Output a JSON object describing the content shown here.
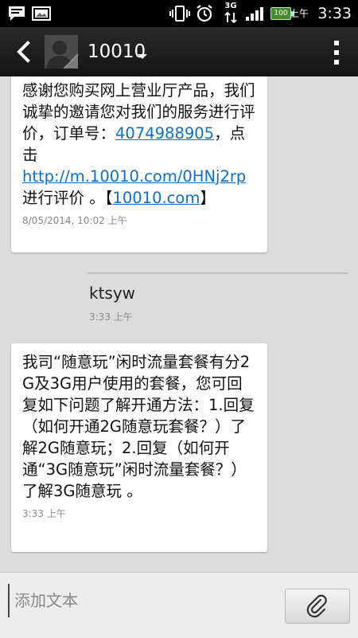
{
  "status_bar": {
    "network": "3G",
    "battery": "100",
    "ampm": "上午",
    "time": "3:33"
  },
  "header": {
    "contact": "10010"
  },
  "messages": [
    {
      "lines_before_link1": "感谢您购买网上营业厅产品，我们诚挚的邀请您对我们的服务进行评价，订单号：",
      "link1": "4074988905",
      "mid1": "，点击",
      "link2": "http://m.10010.com/0HNj2rp",
      "mid2": " 进行评价 。【",
      "link3": "10010.com",
      "end": "】",
      "time": "8/05/2014, 10:02 上午"
    },
    {
      "text": "ktsyw",
      "time": "3:33 上午"
    },
    {
      "text": "我司“随意玩”闲时流量套餐有分2G及3G用户使用的套餐，您可回复如下问题了解开通方法：1.回复（如何开通2G随意玩套餐？）了解2G随意玩；2.回复（如何开通“3G随意玩”闲时流量套餐？）了解3G随意玩 。",
      "time": "3:33 上午"
    }
  ],
  "compose": {
    "placeholder": "添加文本"
  },
  "colors": {
    "link": "#0f6fc6",
    "background": "#dcdcdc",
    "action_bar": "#1c1c1c"
  },
  "icons": {
    "back": "chevron-left-icon",
    "dropdown": "caret-down-icon",
    "overflow": "more-vertical-icon",
    "attach": "paperclip-icon"
  }
}
